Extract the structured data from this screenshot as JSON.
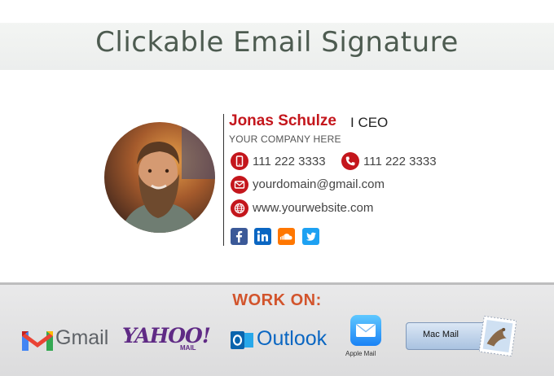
{
  "header": {
    "title": "Clickable Email Signature"
  },
  "signature": {
    "name": "Jonas Schulze",
    "separator_role": "I CEO",
    "company": "YOUR COMPANY HERE",
    "mobile": "111 222 3333",
    "phone": "111 222 3333",
    "email": "yourdomain@gmail.com",
    "website": "www.yourwebsite.com",
    "social_icons": [
      "facebook-icon",
      "linkedin-icon",
      "soundcloud-icon",
      "twitter-icon"
    ]
  },
  "work_on": {
    "heading": "WORK ON:",
    "clients": {
      "gmail": "Gmail",
      "yahoo": "YAHOO!",
      "yahoo_sub": "MAIL",
      "outlook": "Outlook",
      "apple_mail": "Apple Mail",
      "mac_mail": "Mac Mail"
    }
  },
  "colors": {
    "accent_red": "#c4161c",
    "workon_orange": "#d2542c",
    "facebook": "#3b5998",
    "linkedin": "#0a66c2",
    "soundcloud": "#ff7700",
    "twitter": "#1da1f2",
    "yahoo_purple": "#5f2a85",
    "outlook_blue": "#0a66c2"
  }
}
